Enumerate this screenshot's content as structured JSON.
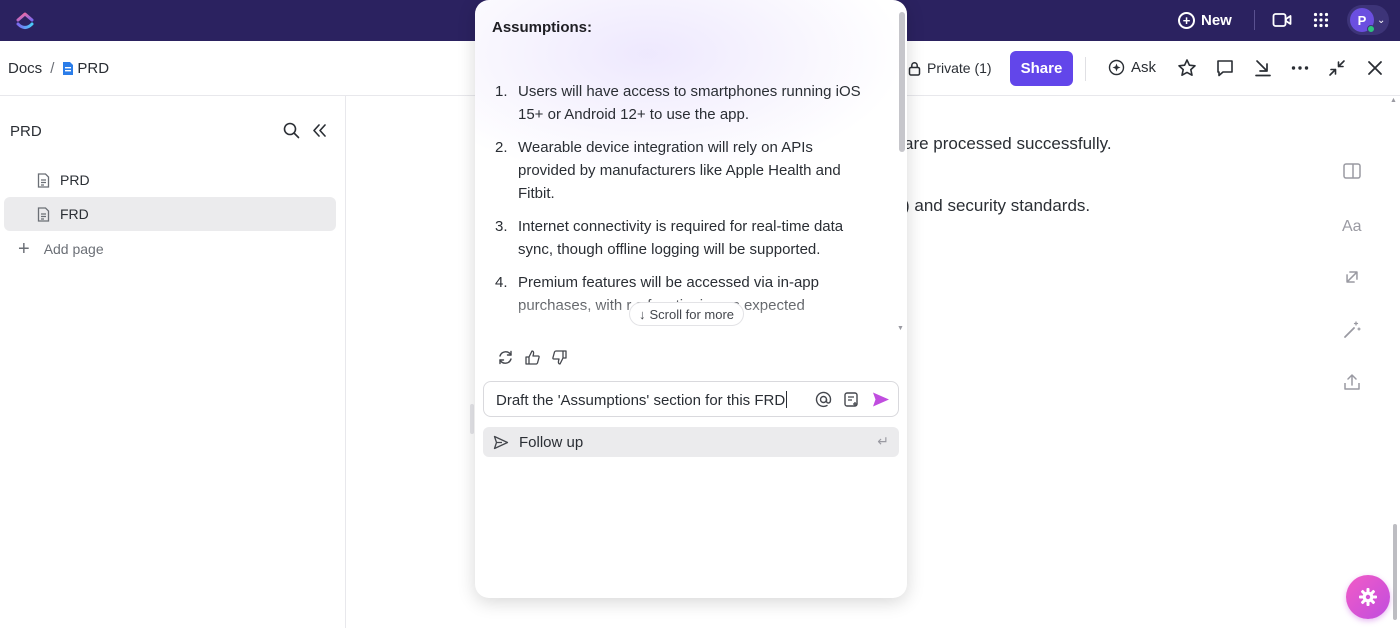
{
  "topbar": {
    "new_label": "New",
    "avatar_initial": "P",
    "icons": [
      "clickup-logo-icon",
      "plus-circle-icon",
      "video-icon",
      "apps-grid-icon",
      "chevron-down-icon"
    ]
  },
  "header": {
    "breadcrumb_root": "Docs",
    "breadcrumb_sep": "/",
    "breadcrumb_doc": "PRD",
    "private_label": "Private (1)",
    "share_label": "Share",
    "ask_label": "Ask"
  },
  "sidebar": {
    "title": "PRD",
    "items": [
      {
        "label": "PRD",
        "active": false
      },
      {
        "label": "FRD",
        "active": true
      }
    ],
    "add_page_label": "Add page"
  },
  "document": {
    "line1": "are processed successfully.",
    "line2": ") and security standards."
  },
  "ai_panel": {
    "heading": "Assumptions:",
    "items": [
      {
        "num": "1.",
        "text": "Users will have access to smartphones running iOS 15+ or Android 12+ to use the app."
      },
      {
        "num": "2.",
        "text": "Wearable device integration will rely on APIs provided by manufacturers like Apple Health and Fitbit."
      },
      {
        "num": "3.",
        "text": "Internet connectivity is required for real-time data sync, though offline logging will be supported."
      },
      {
        "num": "4.",
        "text": "Premium features will be accessed via in-app purchases, with r                  s functioning as expected"
      }
    ],
    "scroll_more_label": "Scroll for more",
    "input_value": "Draft the 'Assumptions' section for this FRD",
    "follow_up_label": "Follow up",
    "enter_glyph": "↵",
    "accent_color": "#c04ddf"
  },
  "colors": {
    "topbar": "#2b2260",
    "share_button": "#6246ea",
    "fab_gradient_start": "#f25bc6",
    "fab_gradient_end": "#c04ddf"
  }
}
